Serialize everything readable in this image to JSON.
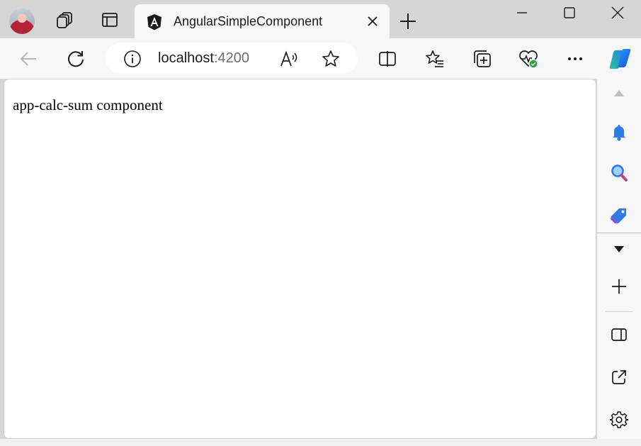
{
  "tab": {
    "title": "AngularSimpleComponent",
    "favicon": "angular-icon"
  },
  "address_bar": {
    "host": "localhost",
    "port": ":4200"
  },
  "page": {
    "content_text": "app-calc-sum component"
  },
  "icons": {
    "titlebar": [
      "profile-avatar",
      "workspaces-icon",
      "tab-actions-icon",
      "new-tab-icon"
    ],
    "window_controls": [
      "minimize-icon",
      "maximize-icon",
      "close-window-icon"
    ],
    "toolbar": [
      "back-icon",
      "refresh-icon",
      "site-info-icon",
      "read-aloud-icon",
      "favorite-star-icon",
      "split-screen-icon",
      "favorites-icon",
      "collections-icon",
      "browser-essentials-icon",
      "more-icon",
      "copilot-icon"
    ],
    "sidebar": [
      "scroll-up-icon",
      "notifications-bell-icon",
      "search-icon",
      "shopping-tag-icon",
      "expand-down-icon",
      "add-icon",
      "hide-sidebar-icon",
      "open-external-icon",
      "settings-gear-icon"
    ]
  },
  "colors": {
    "chrome_bg": "#d6d6d6",
    "toolbar_bg": "#f7f7f7",
    "page_bg": "#ffffff",
    "essentials_badge": "#2ea043",
    "accent_blue": "#1e6fd9"
  }
}
